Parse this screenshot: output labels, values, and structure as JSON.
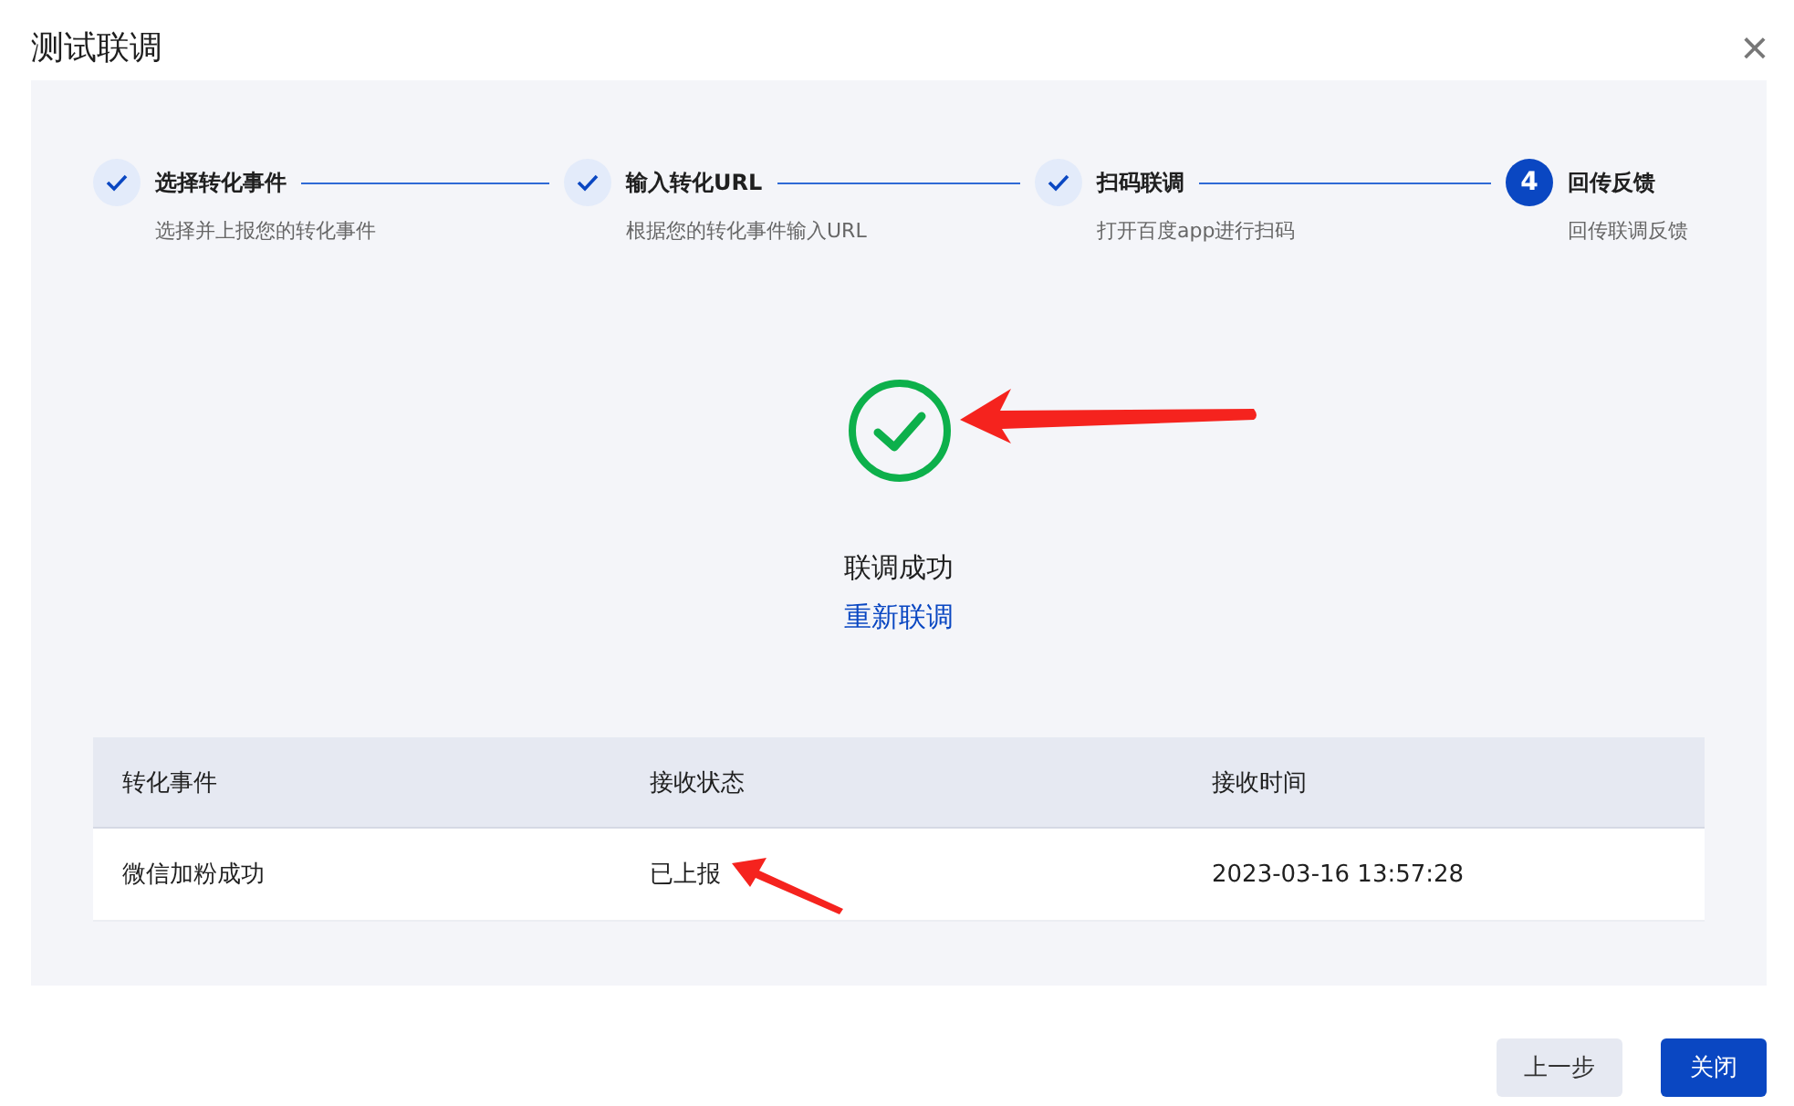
{
  "dialog": {
    "title": "测试联调",
    "close": "×"
  },
  "steps": [
    {
      "title": "选择转化事件",
      "description": "选择并上报您的转化事件",
      "kind": "done"
    },
    {
      "title": "输入转化URL",
      "description": "根据您的转化事件输入URL",
      "kind": "done"
    },
    {
      "title": "扫码联调",
      "description": "打开百度app进行扫码",
      "kind": "done"
    },
    {
      "title": "回传反馈",
      "description": "回传联调反馈",
      "kind": "current",
      "number": "4"
    }
  ],
  "result": {
    "kind": "success",
    "message": "联调成功",
    "link": "重新联调"
  },
  "table": {
    "columns": [
      "转化事件",
      "接收状态",
      "接收时间"
    ],
    "rows": [
      [
        "微信加粉成功",
        "已上报",
        "2023-03-16 13:57:28"
      ]
    ]
  },
  "buttons": [
    {
      "label": "上一步",
      "primary": false
    },
    {
      "label": "关闭",
      "primary": true
    }
  ]
}
